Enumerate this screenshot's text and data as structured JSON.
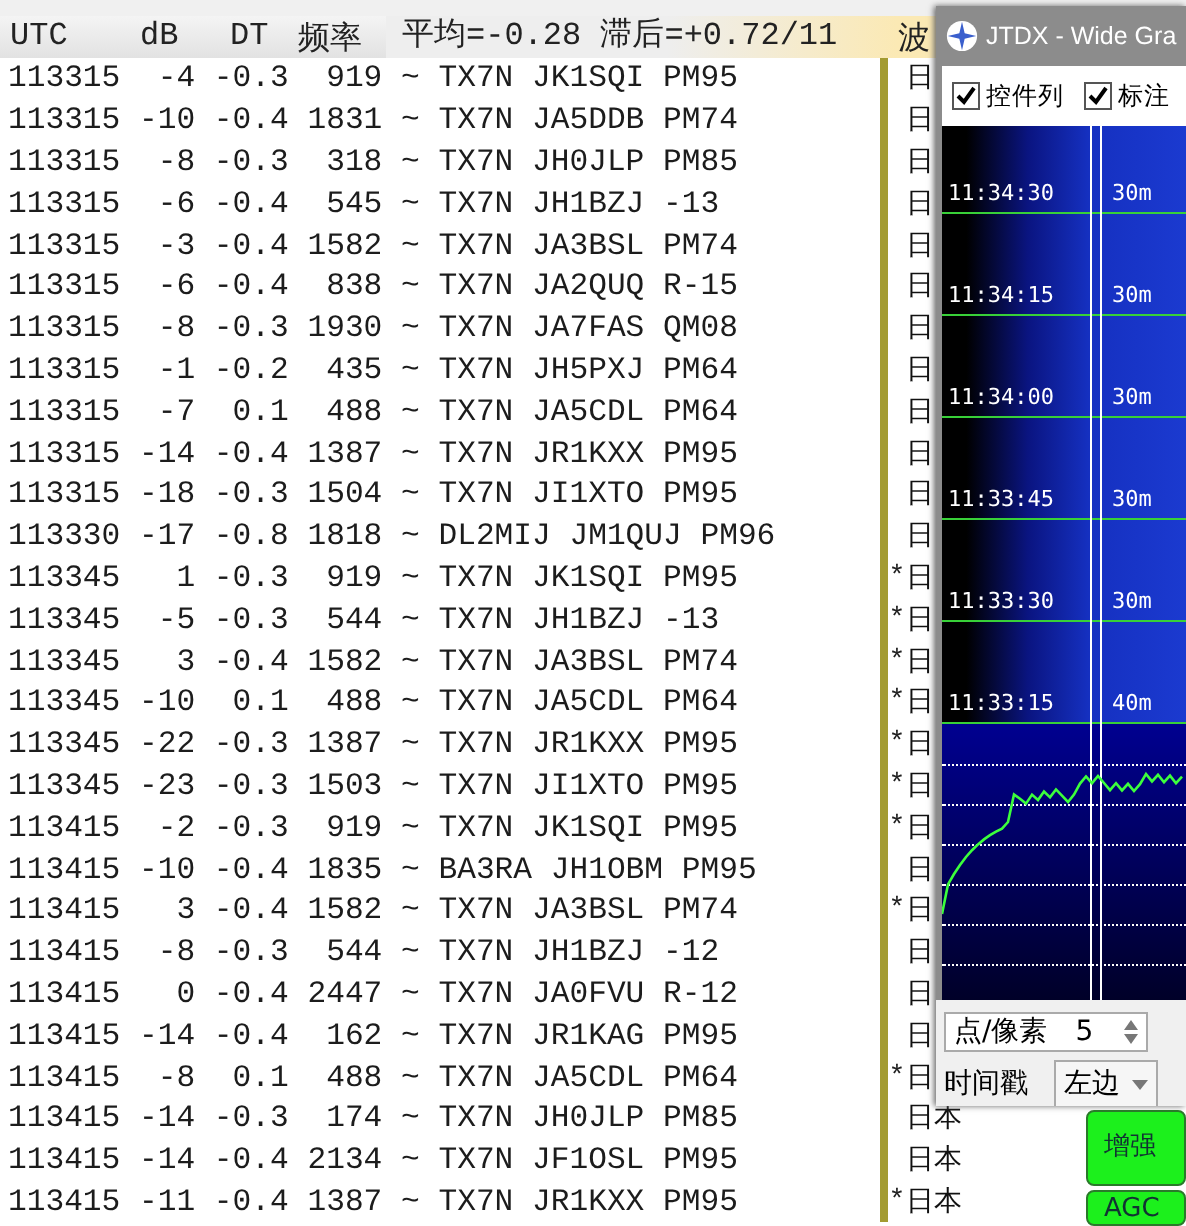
{
  "header": {
    "columns": [
      "UTC",
      "dB",
      "DT",
      "频率"
    ],
    "stats": "平均=-0.28 滞后=+0.72/11",
    "column_6": "波"
  },
  "rows": [
    {
      "text": "113315  -4 -0.3  919 ~ TX7N JK1SQI PM95",
      "country": "日"
    },
    {
      "text": "113315 -10 -0.4 1831 ~ TX7N JA5DDB PM74",
      "country": "日"
    },
    {
      "text": "113315  -8 -0.3  318 ~ TX7N JH0JLP PM85",
      "country": "日"
    },
    {
      "text": "113315  -6 -0.4  545 ~ TX7N JH1BZJ -13",
      "country": "日"
    },
    {
      "text": "113315  -3 -0.4 1582 ~ TX7N JA3BSL PM74",
      "country": "日"
    },
    {
      "text": "113315  -6 -0.4  838 ~ TX7N JA2QUQ R-15",
      "country": "日"
    },
    {
      "text": "113315  -8 -0.3 1930 ~ TX7N JA7FAS QM08",
      "country": "日"
    },
    {
      "text": "113315  -1 -0.2  435 ~ TX7N JH5PXJ PM64",
      "country": "日"
    },
    {
      "text": "113315  -7  0.1  488 ~ TX7N JA5CDL PM64",
      "country": "日"
    },
    {
      "text": "113315 -14 -0.4 1387 ~ TX7N JR1KXX PM95",
      "country": "日"
    },
    {
      "text": "113315 -18 -0.3 1504 ~ TX7N JI1XTO PM95",
      "country": "日"
    },
    {
      "text": "113330 -17 -0.8 1818 ~ DL2MIJ JM1QUJ PM96",
      "country": "日"
    },
    {
      "text": "113345   1 -0.3  919 ~ TX7N JK1SQI PM95",
      "marker": "*",
      "country": "日"
    },
    {
      "text": "113345  -5 -0.3  544 ~ TX7N JH1BZJ -13",
      "marker": "*",
      "country": "日"
    },
    {
      "text": "113345   3 -0.4 1582 ~ TX7N JA3BSL PM74",
      "marker": "*",
      "country": "日"
    },
    {
      "text": "113345 -10  0.1  488 ~ TX7N JA5CDL PM64",
      "marker": "*",
      "country": "日"
    },
    {
      "text": "113345 -22 -0.3 1387 ~ TX7N JR1KXX PM95",
      "marker": "*",
      "country": "日"
    },
    {
      "text": "113345 -23 -0.3 1503 ~ TX7N JI1XTO PM95",
      "marker": "*",
      "country": "日"
    },
    {
      "text": "113415  -2 -0.3  919 ~ TX7N JK1SQI PM95",
      "marker": "*",
      "country": "日"
    },
    {
      "text": "113415 -10 -0.4 1835 ~ BA3RA JH1OBM PM95",
      "country": "日"
    },
    {
      "text": "113415   3 -0.4 1582 ~ TX7N JA3BSL PM74",
      "marker": "*",
      "country": "日"
    },
    {
      "text": "113415  -8 -0.3  544 ~ TX7N JH1BZJ -12",
      "country": "日"
    },
    {
      "text": "113415   0 -0.4 2447 ~ TX7N JA0FVU R-12",
      "country": "日"
    },
    {
      "text": "113415 -14 -0.4  162 ~ TX7N JR1KAG PM95",
      "country": "日"
    },
    {
      "text": "113415  -8  0.1  488 ~ TX7N JA5CDL PM64",
      "marker": "*",
      "country": "日"
    },
    {
      "text": "113415 -14 -0.3  174 ~ TX7N JH0JLP PM85",
      "country": "日本"
    },
    {
      "text": "113415 -14 -0.4 2134 ~ TX7N JF1OSL PM95",
      "country": "日本"
    },
    {
      "text": "113415 -11 -0.4 1387 ~ TX7N JR1KXX PM95",
      "marker": "*",
      "country": "日本"
    }
  ],
  "waterfall_window": {
    "title": "JTDX - Wide Gra",
    "checkboxes": [
      {
        "label": "控件列",
        "checked": true
      },
      {
        "label": "标注",
        "checked": true
      }
    ],
    "time_marks": [
      {
        "time": "11:34:30",
        "band": "30m"
      },
      {
        "time": "11:34:15",
        "band": "30m"
      },
      {
        "time": "11:34:00",
        "band": "30m"
      },
      {
        "time": "11:33:45",
        "band": "30m"
      },
      {
        "time": "11:33:30",
        "band": "30m"
      },
      {
        "time": "11:33:15",
        "band": "40m"
      }
    ],
    "bins_per_pixel": {
      "label": "点/像素",
      "value": "5"
    },
    "timestamp": {
      "label": "时间戳",
      "value": "左边"
    }
  },
  "buttons": [
    "增强",
    "AGC"
  ]
}
